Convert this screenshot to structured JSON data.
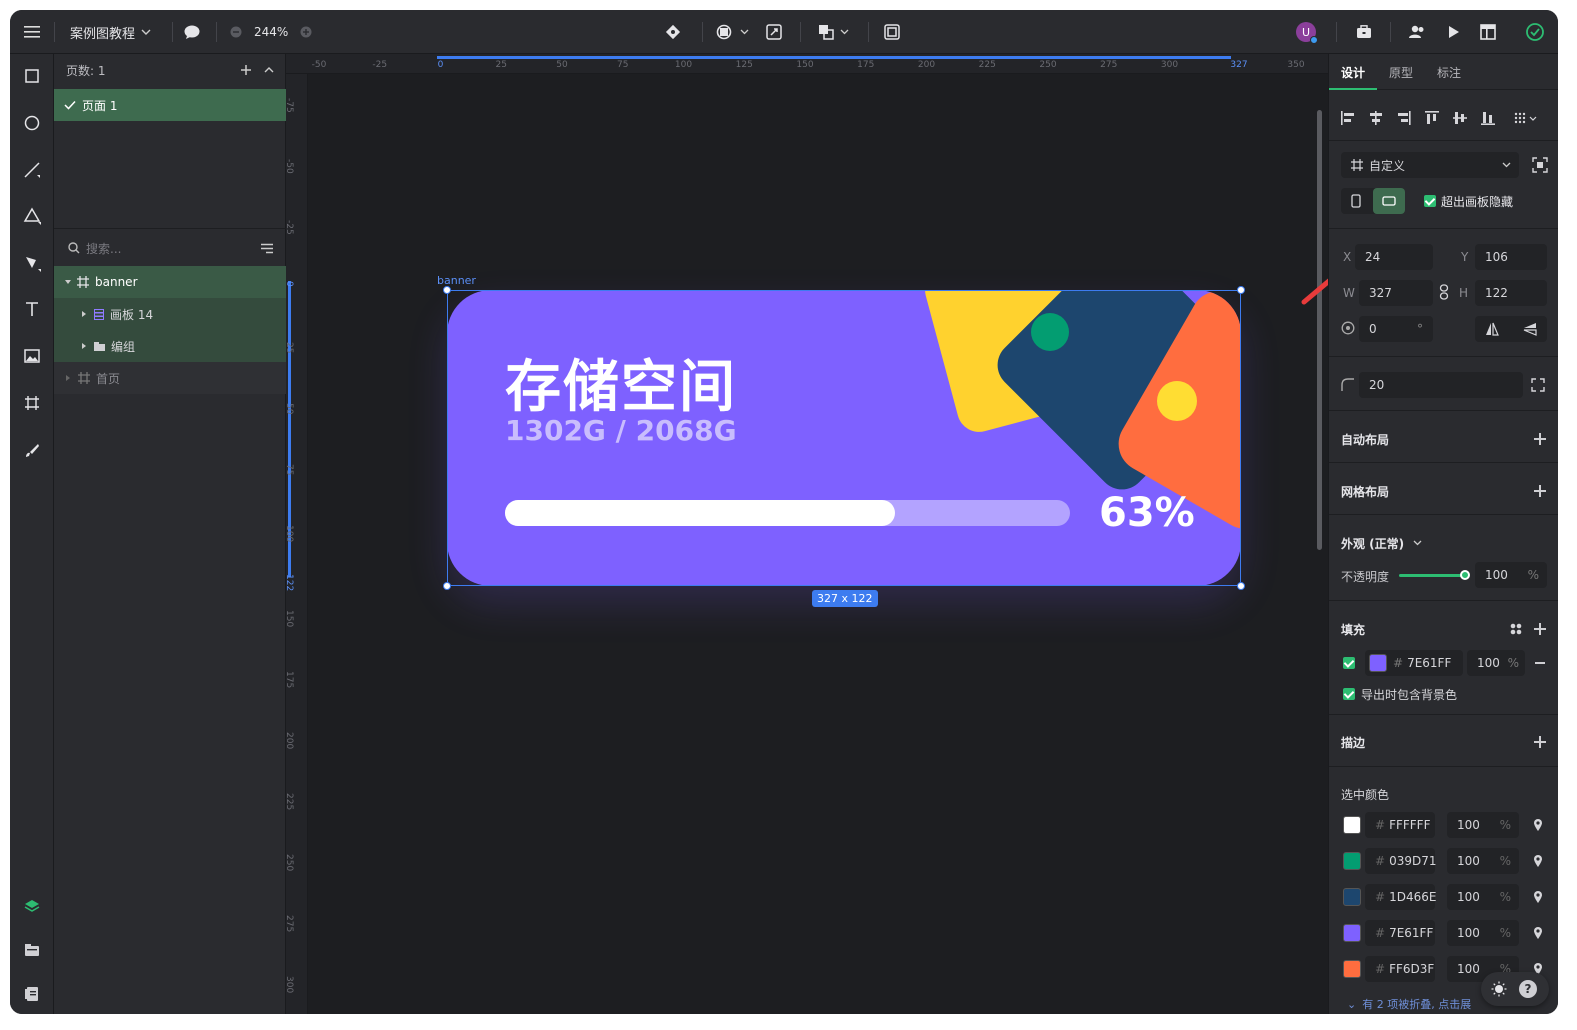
{
  "topbar": {
    "project_name": "案例图教程",
    "zoom": "244%"
  },
  "layers_panel": {
    "pages_label": "页数: 1",
    "page_item": "页面 1",
    "search_placeholder": "搜索...",
    "layers": [
      {
        "label": "banner"
      },
      {
        "label": "画板 14"
      },
      {
        "label": "编组"
      },
      {
        "label": "首页"
      }
    ]
  },
  "canvas": {
    "artboard_label": "banner",
    "size_badge": "327 x 122",
    "ruler_h": [
      "-50",
      "-25",
      "0",
      "25",
      "50",
      "75",
      "100",
      "125",
      "150",
      "175",
      "200",
      "225",
      "250",
      "275",
      "300",
      "327",
      "350"
    ],
    "ruler_v": [
      "-75",
      "-50",
      "-25",
      "0",
      "25",
      "50",
      "75",
      "100",
      "122",
      "150",
      "175",
      "200",
      "225",
      "250",
      "275",
      "300"
    ],
    "banner": {
      "title": "存储空间",
      "subtitle": "1302G / 2068G",
      "percent_text": "63%",
      "progress": 0.69,
      "colors": {
        "bg": "#7E61FF",
        "yellow": "#FFD22E",
        "navy": "#1D466E",
        "orange": "#FF6D3F",
        "green": "#039D71",
        "dot": "#FFDD33"
      }
    }
  },
  "right_panel": {
    "tabs": [
      "设计",
      "原型",
      "标注"
    ],
    "active_tab": "设计",
    "frame_preset": "自定义",
    "clip_label": "超出画板隐藏",
    "x_label": "X",
    "x": "24",
    "y_label": "Y",
    "y": "106",
    "w_label": "W",
    "w": "327",
    "h_label": "H",
    "h": "122",
    "rotation": "0",
    "rotation_unit": "°",
    "radius": "20",
    "auto_layout": "自动布局",
    "grid_layout": "网格布局",
    "appearance": "外观 (正常)",
    "opacity_label": "不透明度",
    "opacity": "100",
    "opacity_unit": "%",
    "fill_title": "填充",
    "fill_hex": "7E61FF",
    "fill_opacity": "100",
    "fill_unit": "%",
    "export_bg": "导出时包含背景色",
    "stroke_title": "描边",
    "selected_colors_title": "选中颜色",
    "selected_colors": [
      {
        "hex": "FFFFFF",
        "color": "#FFFFFF",
        "opacity": "100",
        "unit": "%"
      },
      {
        "hex": "039D71",
        "color": "#039D71",
        "opacity": "100",
        "unit": "%"
      },
      {
        "hex": "1D466E",
        "color": "#1D466E",
        "opacity": "100",
        "unit": "%"
      },
      {
        "hex": "7E61FF",
        "color": "#7E61FF",
        "opacity": "100",
        "unit": "%"
      },
      {
        "hex": "FF6D3F",
        "color": "#FF6D3F",
        "opacity": "100",
        "unit": "%"
      }
    ],
    "collapsed_note": "有 2 项被折叠, 点击展"
  },
  "accent": "#2dbd72",
  "selection_color": "#3d7cf0"
}
